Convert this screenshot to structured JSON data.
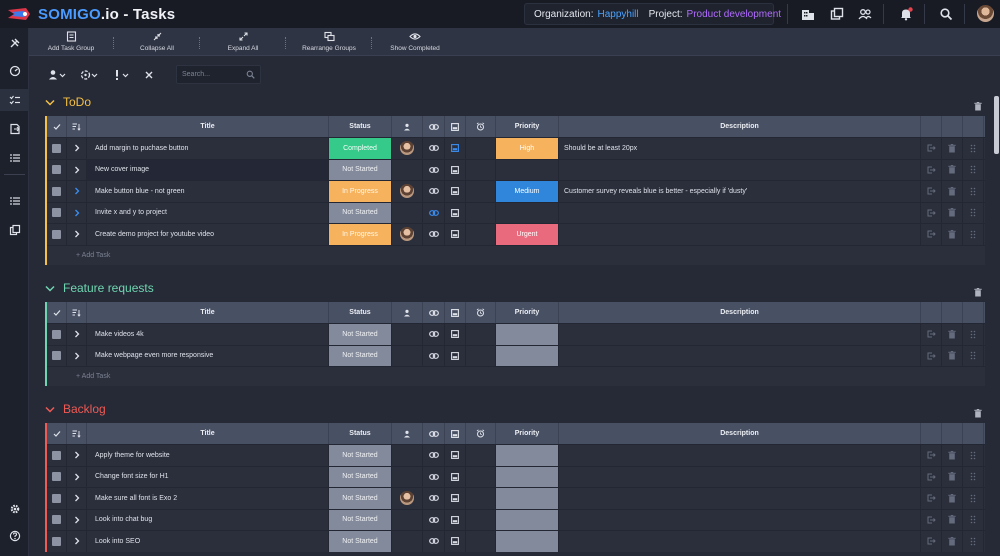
{
  "app": {
    "brand_part": "SOMIGO",
    "name_part": ".io - Tasks",
    "org_label": "Organization:",
    "org_value": "Happyhill",
    "project_label": "Project:",
    "project_value": "Product development",
    "notification_badge_color": "#e8434d"
  },
  "colors": {
    "accent": "#4b9bff",
    "project": "#b06cff",
    "todo": "#f5c044",
    "feature": "#6fd5b0",
    "backlog": "#ef5a55"
  },
  "toolbar": {
    "add_task_group": "Add Task Group",
    "collapse_all": "Collapse All",
    "expand_all": "Expand All",
    "rearrange_groups": "Rearrange Groups",
    "show_completed": "Show Completed"
  },
  "filters": {
    "search_placeholder": "Search..."
  },
  "table_headers": {
    "title": "Title",
    "status": "Status",
    "priority": "Priority",
    "description": "Description"
  },
  "add_task_label": "+ Add Task",
  "groups": [
    {
      "title": "ToDo",
      "color": "#f5c044",
      "tasks": [
        {
          "title": "Add margin to puchase button",
          "status": "Completed",
          "assignee": true,
          "link_color": "#d8dbe3",
          "image_color": "#3b8ef0",
          "priority": "High",
          "description": "Should be at least 20px"
        },
        {
          "title": "New cover image",
          "status": "Not Started",
          "assignee": false,
          "link_color": "#d8dbe3",
          "image_color": "#d8dbe3",
          "priority": "",
          "description": ""
        },
        {
          "title": "Make button blue - not green",
          "status": "In Progress",
          "assignee": true,
          "link_color": "#d8dbe3",
          "image_color": "#d8dbe3",
          "priority": "Medium",
          "description": "Customer survey reveals blue is better - especially if 'dusty'"
        },
        {
          "title": "Invite x and y to project",
          "status": "Not Started",
          "assignee": false,
          "link_color": "#3b8ef0",
          "image_color": "#d8dbe3",
          "priority": "",
          "description": ""
        },
        {
          "title": "Create demo project for youtube video",
          "status": "In Progress",
          "assignee": true,
          "link_color": "#d8dbe3",
          "image_color": "#d8dbe3",
          "priority": "Urgent",
          "description": ""
        }
      ]
    },
    {
      "title": "Feature requests",
      "color": "#6fd5b0",
      "tasks": [
        {
          "title": "Make videos 4k",
          "status": "Not Started",
          "assignee": false,
          "link_color": "#d8dbe3",
          "image_color": "#d8dbe3",
          "priority": "",
          "description": ""
        },
        {
          "title": "Make webpage even more responsive",
          "status": "Not Started",
          "assignee": false,
          "link_color": "#d8dbe3",
          "image_color": "#d8dbe3",
          "priority": "",
          "description": ""
        }
      ]
    },
    {
      "title": "Backlog",
      "color": "#ef5a55",
      "tasks": [
        {
          "title": "Apply theme for website",
          "status": "Not Started",
          "assignee": false,
          "link_color": "#d8dbe3",
          "image_color": "#d8dbe3",
          "priority": "",
          "description": ""
        },
        {
          "title": "Change font size for H1",
          "status": "Not Started",
          "assignee": false,
          "link_color": "#d8dbe3",
          "image_color": "#d8dbe3",
          "priority": "",
          "description": ""
        },
        {
          "title": "Make sure all font is Exo 2",
          "status": "Not Started",
          "assignee": true,
          "link_color": "#d8dbe3",
          "image_color": "#d8dbe3",
          "priority": "",
          "description": ""
        },
        {
          "title": "Look into chat bug",
          "status": "Not Started",
          "assignee": false,
          "link_color": "#d8dbe3",
          "image_color": "#d8dbe3",
          "priority": "",
          "description": ""
        },
        {
          "title": "Look into SEO",
          "status": "Not Started",
          "assignee": false,
          "link_color": "#d8dbe3",
          "image_color": "#d8dbe3",
          "priority": "",
          "description": ""
        }
      ]
    }
  ]
}
